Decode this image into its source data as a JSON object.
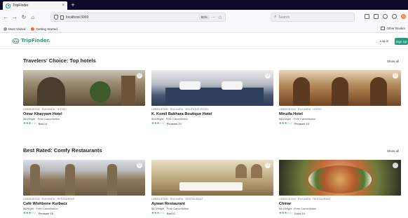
{
  "browser": {
    "tab_title": "TripFinder",
    "new_tab_symbol": "+",
    "url": "localhost:3000",
    "zoom": "80%",
    "search_placeholder": "Search",
    "bookmarks": [
      "Most Visited",
      "Getting Started"
    ],
    "other_bookmarks": "Other Bookm"
  },
  "site": {
    "logo": "TripFinder.",
    "login": "Log in",
    "signup": "Sign Up"
  },
  "hotels": {
    "title": "Travelers' Choice: Top hotels",
    "show_all": "Show all",
    "items": [
      {
        "meta": "UZBEKISTAN · BUKHARA · HOTEL",
        "name": "Omar Khayyam Hotel",
        "sub": "$40/Night · Free Cancellation",
        "stars": "★★★☆☆",
        "reviews": "Bad 14"
      },
      {
        "meta": "UZBEKISTAN · BUKHARA · BOUTIQUE HOTEL",
        "name": "K. Komil Bukhara Boutique Hotel",
        "sub": "$45/Night · Free Cancellation",
        "stars": "★★★☆☆",
        "reviews": "Pleasant 22"
      },
      {
        "meta": "UZBEKISTAN · BUKHARA · HOTEL",
        "name": "Minzifa Hotel",
        "sub": "$40/Night · Free Cancellation",
        "stars": "★★★☆☆",
        "reviews": "Pleasant 18"
      }
    ]
  },
  "restaurants": {
    "title": "Best Rated: Comfy Restaurants",
    "show_all": "Show all",
    "items": [
      {
        "meta": "UZBEKISTAN · BUKHARA · RESTAURANT",
        "name": "Café Wishbone Kurbacz",
        "sub": "$8/Night · Free Cancellation",
        "stars": "★★★☆☆",
        "reviews": "Pleasant 15"
      },
      {
        "meta": "UZBEKISTAN · BUKHARA · RESTAURANT",
        "name": "Aywan Restaurant",
        "sub": "$4.5/Night · Free Cancellation",
        "stars": "★★★☆☆",
        "reviews": "Bad 12"
      },
      {
        "meta": "UZBEKISTAN · BUKHARA · RESTAURANT",
        "name": "Chinar",
        "sub": "$4.5/Night · Free Cancellation",
        "stars": "★★★☆☆",
        "reviews": "Good 10"
      }
    ]
  },
  "colors": {
    "brand": "#2a9a7e",
    "tabbar": "#0c0c2a"
  }
}
